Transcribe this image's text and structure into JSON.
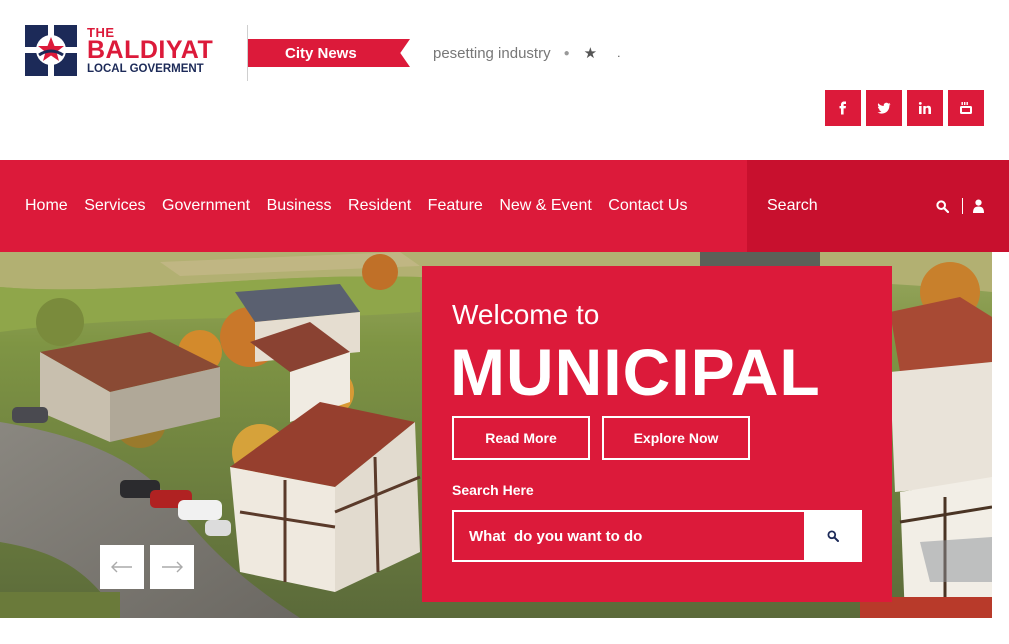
{
  "brand": {
    "the": "THE",
    "name": "BALDIYAT",
    "tagline": "LOCAL GOVERMENT"
  },
  "ticker": {
    "label": "City News",
    "text": "pesetting industry"
  },
  "socials": [
    {
      "icon": "facebook-icon",
      "glyph": "f"
    },
    {
      "icon": "twitter-icon",
      "glyph": "t"
    },
    {
      "icon": "linkedin-icon",
      "glyph": "in"
    },
    {
      "icon": "youtube-icon",
      "glyph": "yt"
    }
  ],
  "nav": {
    "items": [
      "Home",
      "Services",
      "Government",
      "Business",
      "Resident",
      "Feature",
      "New & Event",
      "Contact Us"
    ],
    "search_placeholder": "Search"
  },
  "hero": {
    "subtitle": "Welcome to",
    "title": "MUNICIPAL",
    "read_more": "Read More",
    "explore_now": "Explore Now",
    "search_label": "Search Here",
    "search_placeholder": "What  do you want to do"
  },
  "colors": {
    "accent": "#dc1a3a",
    "accent_dark": "#c8102e",
    "navy": "#1c2a58"
  }
}
